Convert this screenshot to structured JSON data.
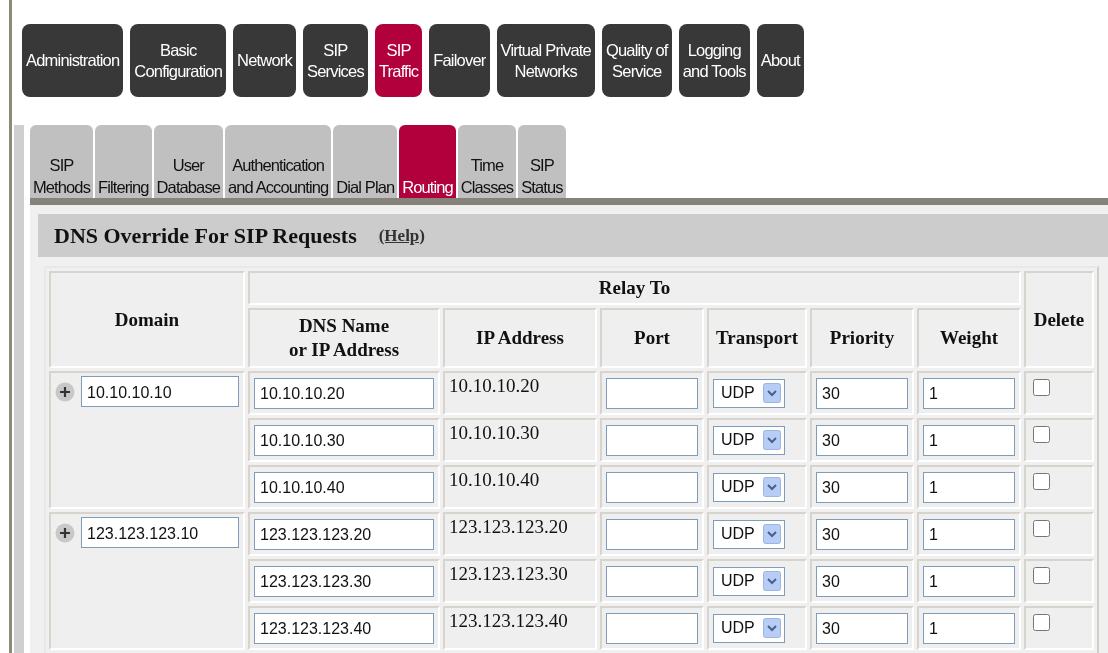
{
  "nav": [
    {
      "label": "Administration",
      "selected": false
    },
    {
      "label": "Basic\nConfiguration",
      "selected": false
    },
    {
      "label": "Network",
      "selected": false
    },
    {
      "label": "SIP\nServices",
      "selected": false
    },
    {
      "label": "SIP\nTraffic",
      "selected": true
    },
    {
      "label": "Failover",
      "selected": false
    },
    {
      "label": "Virtual Private\nNetworks",
      "selected": false
    },
    {
      "label": "Quality of\nService",
      "selected": false
    },
    {
      "label": "Logging\nand Tools",
      "selected": false
    },
    {
      "label": "About",
      "selected": false
    }
  ],
  "subtabs": [
    {
      "label": "SIP\nMethods",
      "selected": false
    },
    {
      "label": "Filtering",
      "selected": false
    },
    {
      "label": "User\nDatabase",
      "selected": false
    },
    {
      "label": "Authentication\nand Accounting",
      "selected": false
    },
    {
      "label": "Dial Plan",
      "selected": false
    },
    {
      "label": "Routing",
      "selected": true
    },
    {
      "label": "Time\nClasses",
      "selected": false
    },
    {
      "label": "SIP\nStatus",
      "selected": false
    }
  ],
  "section": {
    "title": "DNS Override For SIP Requests",
    "help": "(Help)"
  },
  "table": {
    "columns": {
      "domain": "Domain",
      "relay_to": "Relay To",
      "dns": "DNS Name\nor IP Address",
      "ip": "IP Address",
      "port": "Port",
      "transport": "Transport",
      "priority": "Priority",
      "weight": "Weight",
      "delete": "Delete"
    },
    "groups": [
      {
        "domain": "10.10.10.10",
        "rows": [
          {
            "dns": "10.10.10.20",
            "ip": "10.10.10.20",
            "transport": "UDP",
            "priority": "30",
            "weight": "1",
            "delete": false
          },
          {
            "dns": "10.10.10.30",
            "ip": "10.10.10.30",
            "transport": "UDP",
            "priority": "30",
            "weight": "1",
            "delete": false
          },
          {
            "dns": "10.10.10.40",
            "ip": "10.10.10.40",
            "transport": "UDP",
            "priority": "30",
            "weight": "1",
            "delete": false
          }
        ]
      },
      {
        "domain": "123.123.123.10",
        "rows": [
          {
            "dns": "123.123.123.20",
            "ip": "123.123.123.20",
            "transport": "UDP",
            "priority": "30",
            "weight": "1",
            "delete": false
          },
          {
            "dns": "123.123.123.30",
            "ip": "123.123.123.30",
            "transport": "UDP",
            "priority": "30",
            "weight": "1",
            "delete": false
          },
          {
            "dns": "123.123.123.40",
            "ip": "123.123.123.40",
            "transport": "UDP",
            "priority": "30",
            "weight": "1",
            "delete": false
          }
        ]
      }
    ]
  }
}
